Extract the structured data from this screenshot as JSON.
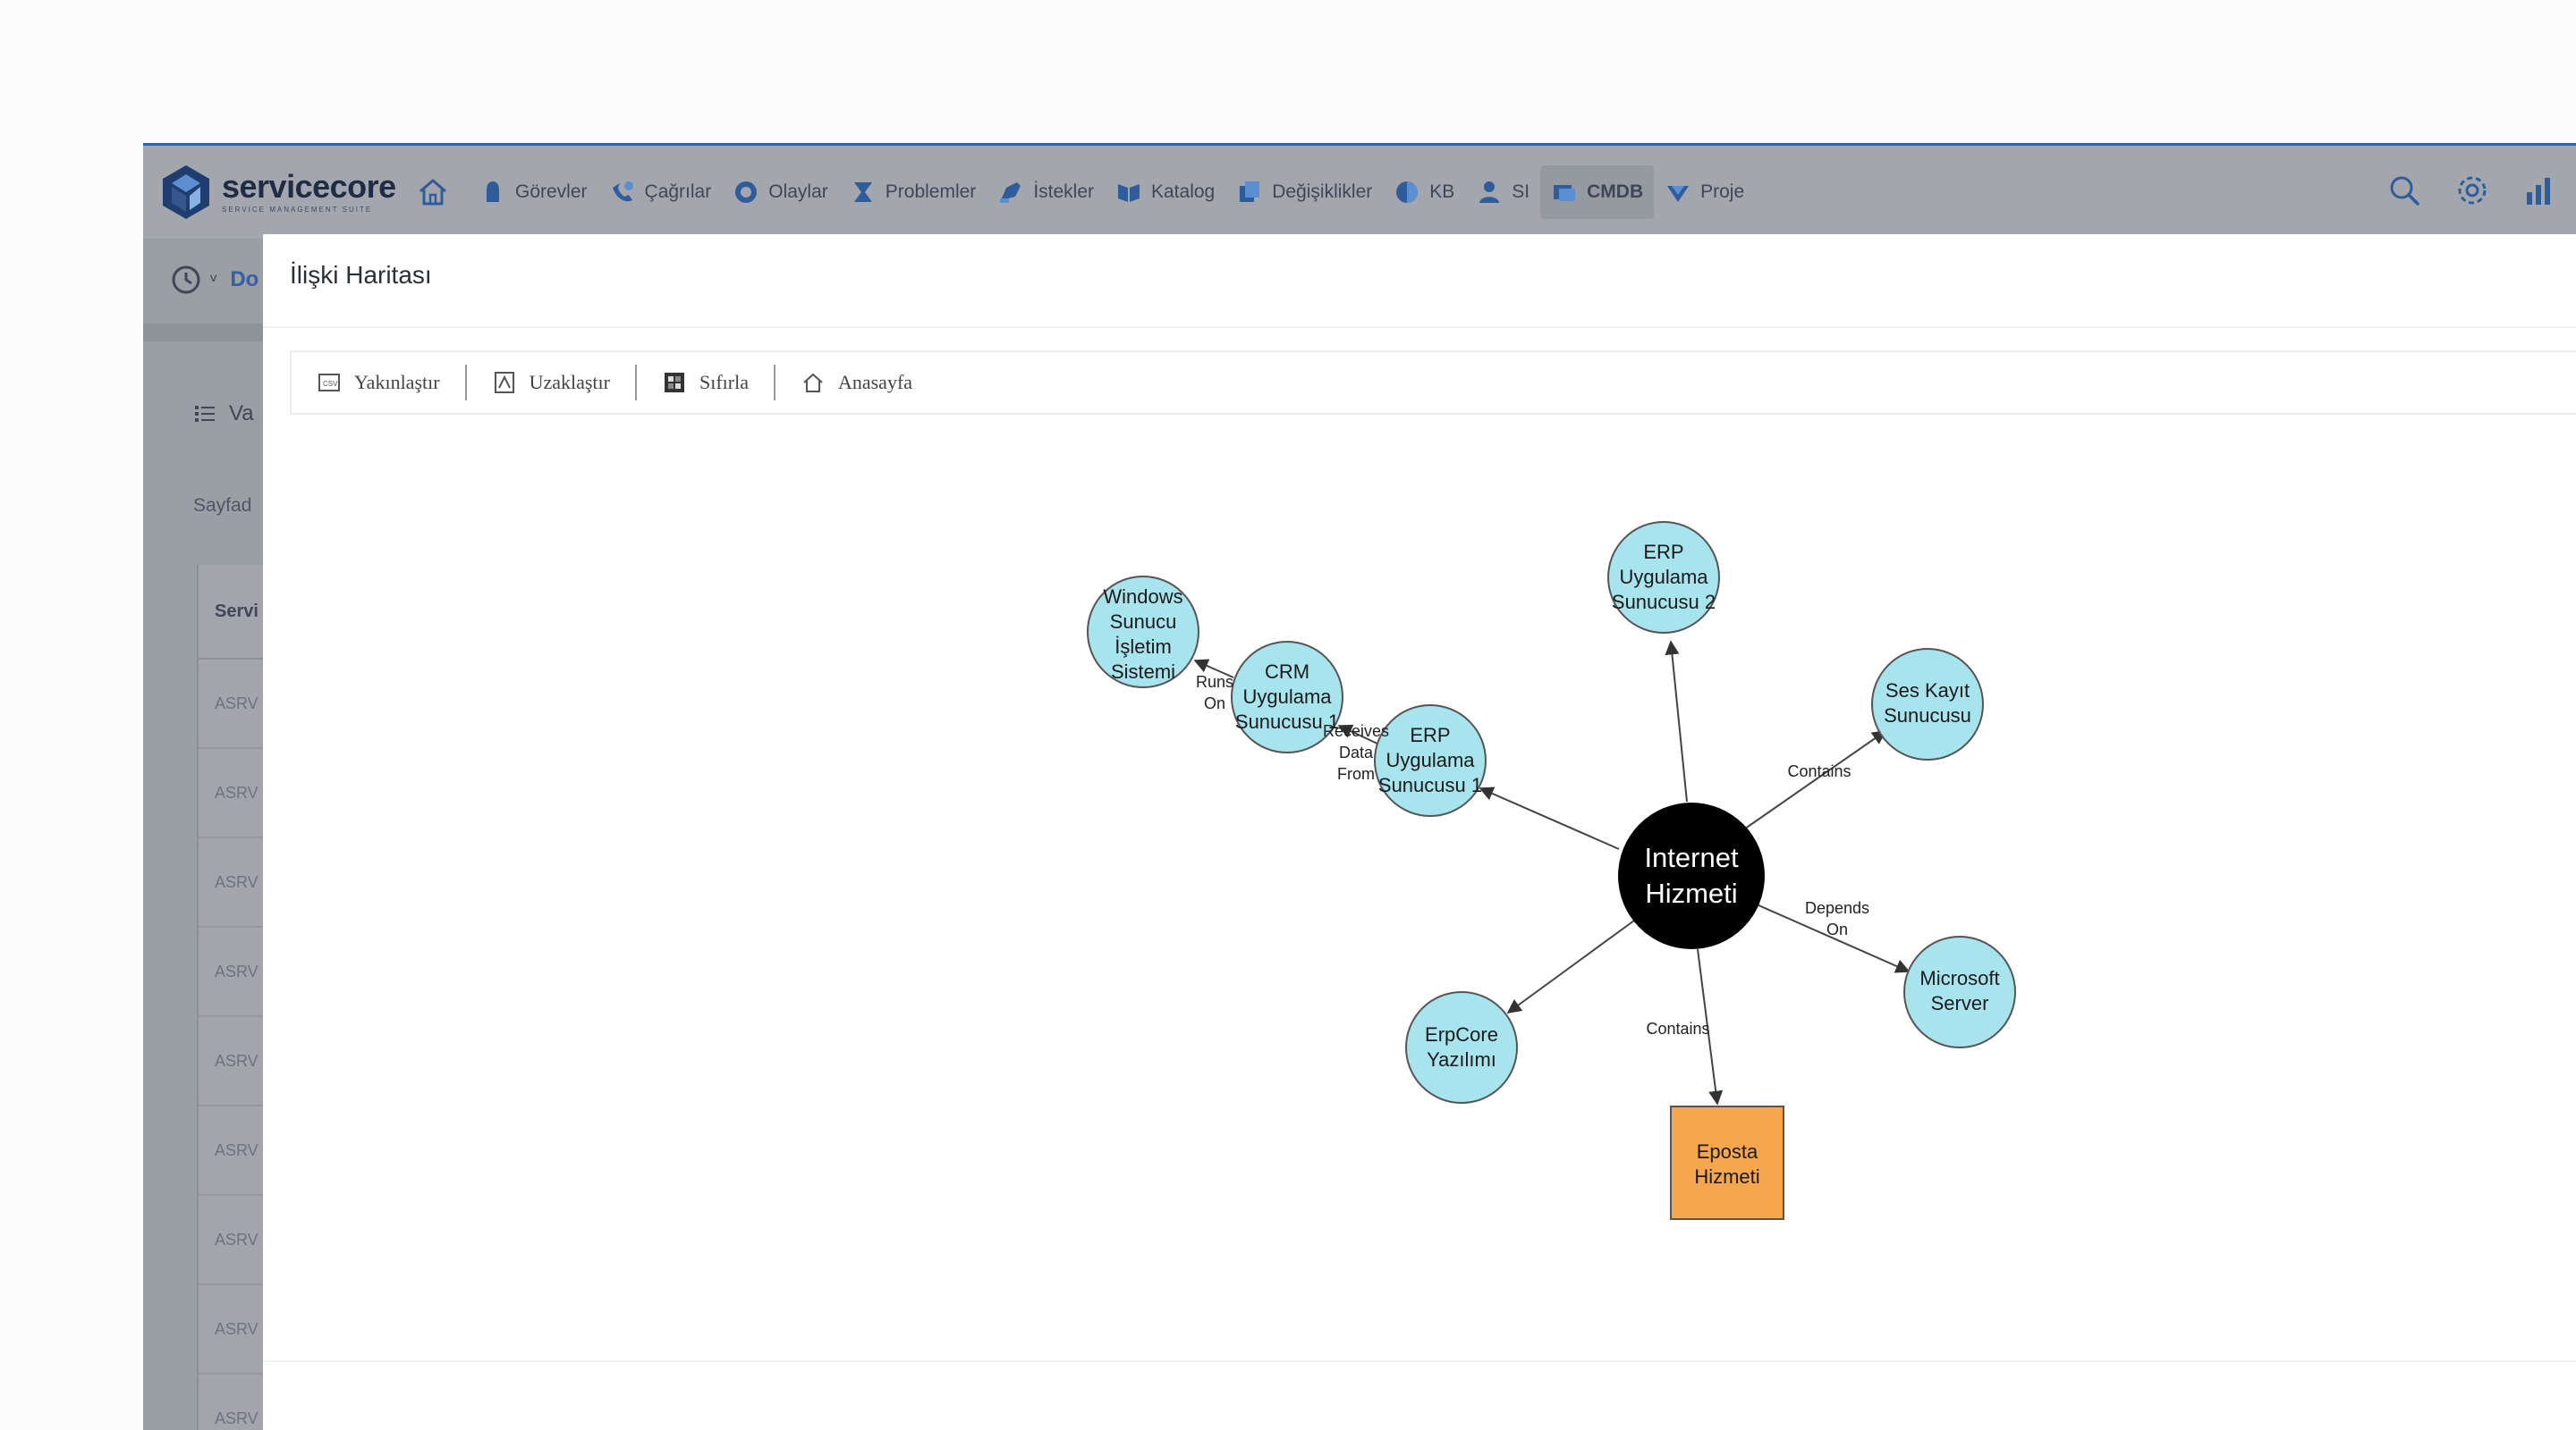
{
  "app": {
    "brand": "servicecore",
    "tagline": "SERVICE MANAGEMENT SUITE"
  },
  "nav": {
    "items": [
      {
        "label": "Görevler",
        "icon": "tasks-icon"
      },
      {
        "label": "Çağrılar",
        "icon": "calls-icon"
      },
      {
        "label": "Olaylar",
        "icon": "incidents-icon"
      },
      {
        "label": "Problemler",
        "icon": "problems-icon"
      },
      {
        "label": "İstekler",
        "icon": "requests-icon"
      },
      {
        "label": "Katalog",
        "icon": "catalog-icon"
      },
      {
        "label": "Değişiklikler",
        "icon": "changes-icon"
      },
      {
        "label": "KB",
        "icon": "kb-icon"
      },
      {
        "label": "SI",
        "icon": "si-icon"
      },
      {
        "label": "CMDB",
        "icon": "cmdb-icon",
        "active": true
      },
      {
        "label": "Proje",
        "icon": "project-icon"
      }
    ]
  },
  "background": {
    "subbar_text": "Do",
    "list_title": "Va",
    "page_label": "Sayfad",
    "table_header": "Servi",
    "rows": [
      "ASRV",
      "ASRV",
      "ASRV",
      "ASRV",
      "ASRV",
      "ASRV",
      "ASRV",
      "ASRV",
      "ASRV"
    ]
  },
  "modal": {
    "title": "İlişki Haritası",
    "toolbar": {
      "zoom_in": "Yakınlaştır",
      "zoom_out": "Uzaklaştır",
      "reset": "Sıfırla",
      "home": "Anasayfa"
    }
  },
  "graph": {
    "colors": {
      "node_fill": "#a8e4ee",
      "center_fill": "#000000",
      "service_fill": "#f6a64c",
      "edge": "#444444"
    },
    "nodes": {
      "center": [
        "Internet",
        "Hizmeti"
      ],
      "erp2": [
        "ERP",
        "Uygulama",
        "Sunucusu 2"
      ],
      "ses": [
        "Ses Kayıt",
        "Sunucusu"
      ],
      "microsoft": [
        "Microsoft",
        "Server"
      ],
      "eposta": [
        "Eposta",
        "Hizmeti"
      ],
      "erpcore": [
        "ErpCore",
        "Yazılımı"
      ],
      "erp1": [
        "ERP",
        "Uygulama",
        "Sunucusu 1"
      ],
      "crm": [
        "CRM",
        "Uygulama",
        "Sunucusu 1"
      ],
      "windows": [
        "Windows",
        "Sunucu",
        "İşletim",
        "Sistemi"
      ]
    },
    "edge_labels": {
      "ses": [
        "Contains"
      ],
      "microsoft": [
        "Depends",
        "On"
      ],
      "eposta": [
        "Contains"
      ],
      "erp1_crm": [
        "Receives",
        "Data",
        "From"
      ],
      "crm_windows": [
        "Runs",
        "On"
      ]
    }
  }
}
